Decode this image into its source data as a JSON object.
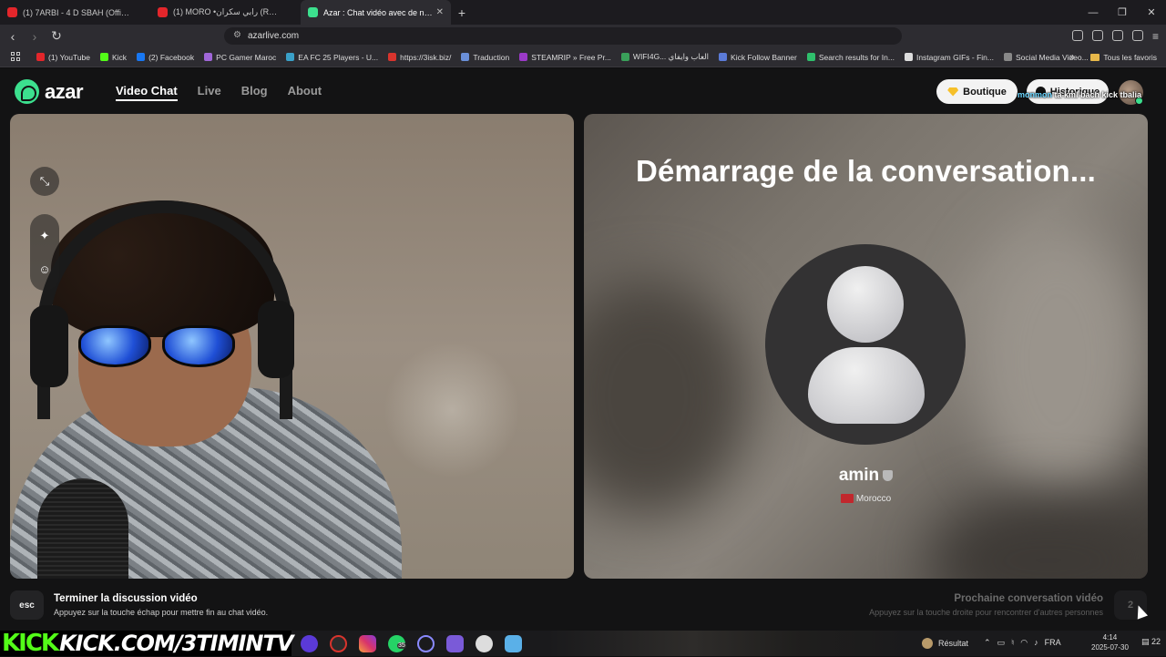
{
  "browser": {
    "tabs": [
      {
        "title": "(1) 7ARBI - 4 D SBAH (Official lyrics v...",
        "color": "#e3262b",
        "active": false
      },
      {
        "title": "(1) MORO •رابي سكران (REMIX BY EL...",
        "color": "#e3262b",
        "active": false
      },
      {
        "title": "Azar : Chat vidéo avec de no...",
        "color": "#3ce08e",
        "active": true
      }
    ],
    "new_tab": "+",
    "url": "azarlive.com",
    "window_controls": [
      "—",
      "❐",
      "✕"
    ]
  },
  "bookmarks": [
    {
      "label": "(1) YouTube",
      "color": "#e3262b"
    },
    {
      "label": "Kick",
      "color": "#53fc18"
    },
    {
      "label": "(2) Facebook",
      "color": "#1877f2"
    },
    {
      "label": "PC Gamer Maroc",
      "color": "#a067d8"
    },
    {
      "label": "EA FC 25 Players - U...",
      "color": "#3aa0c8"
    },
    {
      "label": "https://3isk.biz/",
      "color": "#d8342d"
    },
    {
      "label": "Traduction",
      "color": "#6a8fd8"
    },
    {
      "label": "STEAMRIP » Free Pr...",
      "color": "#9b3ac8"
    },
    {
      "label": "WIFI4G... العاب وايفاي",
      "color": "#3aa05a"
    },
    {
      "label": "Kick Follow Banner",
      "color": "#5b7bd8"
    },
    {
      "label": "Search results for In...",
      "color": "#2fbf6c"
    },
    {
      "label": "Instagram GIFs - Fin...",
      "color": "#dddddd"
    },
    {
      "label": "Social Media Video...",
      "color": "#888888"
    }
  ],
  "bookmarks_more": "»",
  "bookmarks_folder": "Tous les favoris",
  "azar": {
    "logo": "azar",
    "nav": [
      "Video Chat",
      "Live",
      "Blog",
      "About"
    ],
    "boutique": "Boutique",
    "historique": "Historique",
    "stream_overlay": {
      "user": "monmon",
      "message": "ta kml bach kick tbalia"
    },
    "connecting_title": "Démarrage de la conversation...",
    "partner_name": "amin",
    "partner_country": "Morocco",
    "end": {
      "key": "esc",
      "title": "Terminer la discussion vidéo",
      "subtitle": "Appuyez sur la touche échap pour mettre fin au chat vidéo."
    },
    "next": {
      "key": "2",
      "title": "Prochaine conversation vidéo",
      "subtitle": "Appuyez sur la touche droite pour rencontrer d'autres personnes"
    }
  },
  "taskbar": {
    "banner_logo": "KICK",
    "banner_url": "KICK.COM/3TIMINTV",
    "badge_count": "35",
    "result": "Résultat",
    "lang": "FRA",
    "time": "4:14",
    "date": "2025-07-30",
    "notifications": "22"
  }
}
